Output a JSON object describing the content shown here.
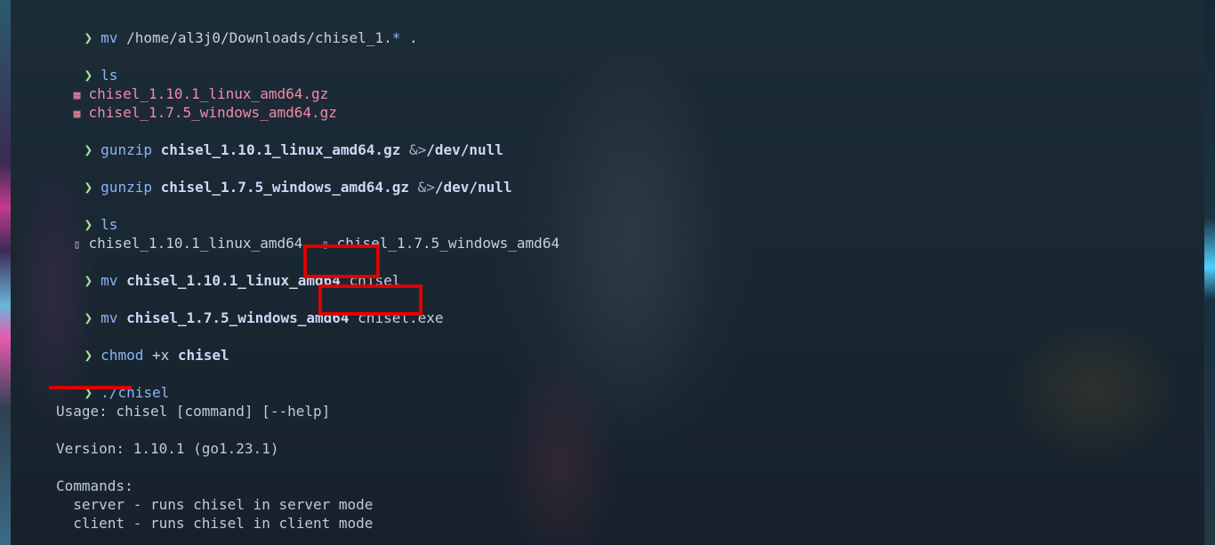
{
  "prompt_symbol": "❯",
  "lines": {
    "l1": {
      "cmd": "mv",
      "rest": "/home/al3j0/Downloads/chisel_1.",
      "glob": "*",
      "dot": " ."
    },
    "l2": {
      "cmd": "ls"
    },
    "l3": {
      "icon": "archive-icon",
      "name": "chisel_1.10.1_linux_amd64.gz"
    },
    "l4": {
      "icon": "archive-icon",
      "name": "chisel_1.7.5_windows_amd64.gz"
    },
    "l5": {
      "cmd": "gunzip",
      "file": "chisel_1.10.1_linux_amd64.gz",
      "redir": "&>",
      "target": "/dev/null"
    },
    "l6": {
      "cmd": "gunzip",
      "file": "chisel_1.7.5_windows_amd64.gz",
      "redir": "&>",
      "target": "/dev/null"
    },
    "l7": {
      "cmd": "ls"
    },
    "l8": {
      "files": [
        "chisel_1.10.1_linux_amd64",
        "chisel_1.7.5_windows_amd64"
      ]
    },
    "l9": {
      "cmd": "mv",
      "src": "chisel_1.10.1_linux_amd64",
      "dst": "chisel"
    },
    "l10": {
      "cmd": "mv",
      "src": "chisel_1.7.5_windows_amd64",
      "dst": "chisel.exe"
    },
    "l11": {
      "cmd": "chmod",
      "flag": "+x",
      "file": "chisel"
    },
    "l12": {
      "cmd": "./chisel"
    }
  },
  "output": {
    "usage": "Usage: chisel [command] [--help]",
    "version": "Version: 1.10.1 (go1.23.1)",
    "commands_header": "Commands:",
    "server": "  server - runs chisel in server mode",
    "client": "  client - runs chisel in client mode"
  },
  "colors": {
    "prompt": "#a6e3a1",
    "command": "#89b4fa",
    "archive": "#f38ba8",
    "highlight": "#e00000"
  }
}
